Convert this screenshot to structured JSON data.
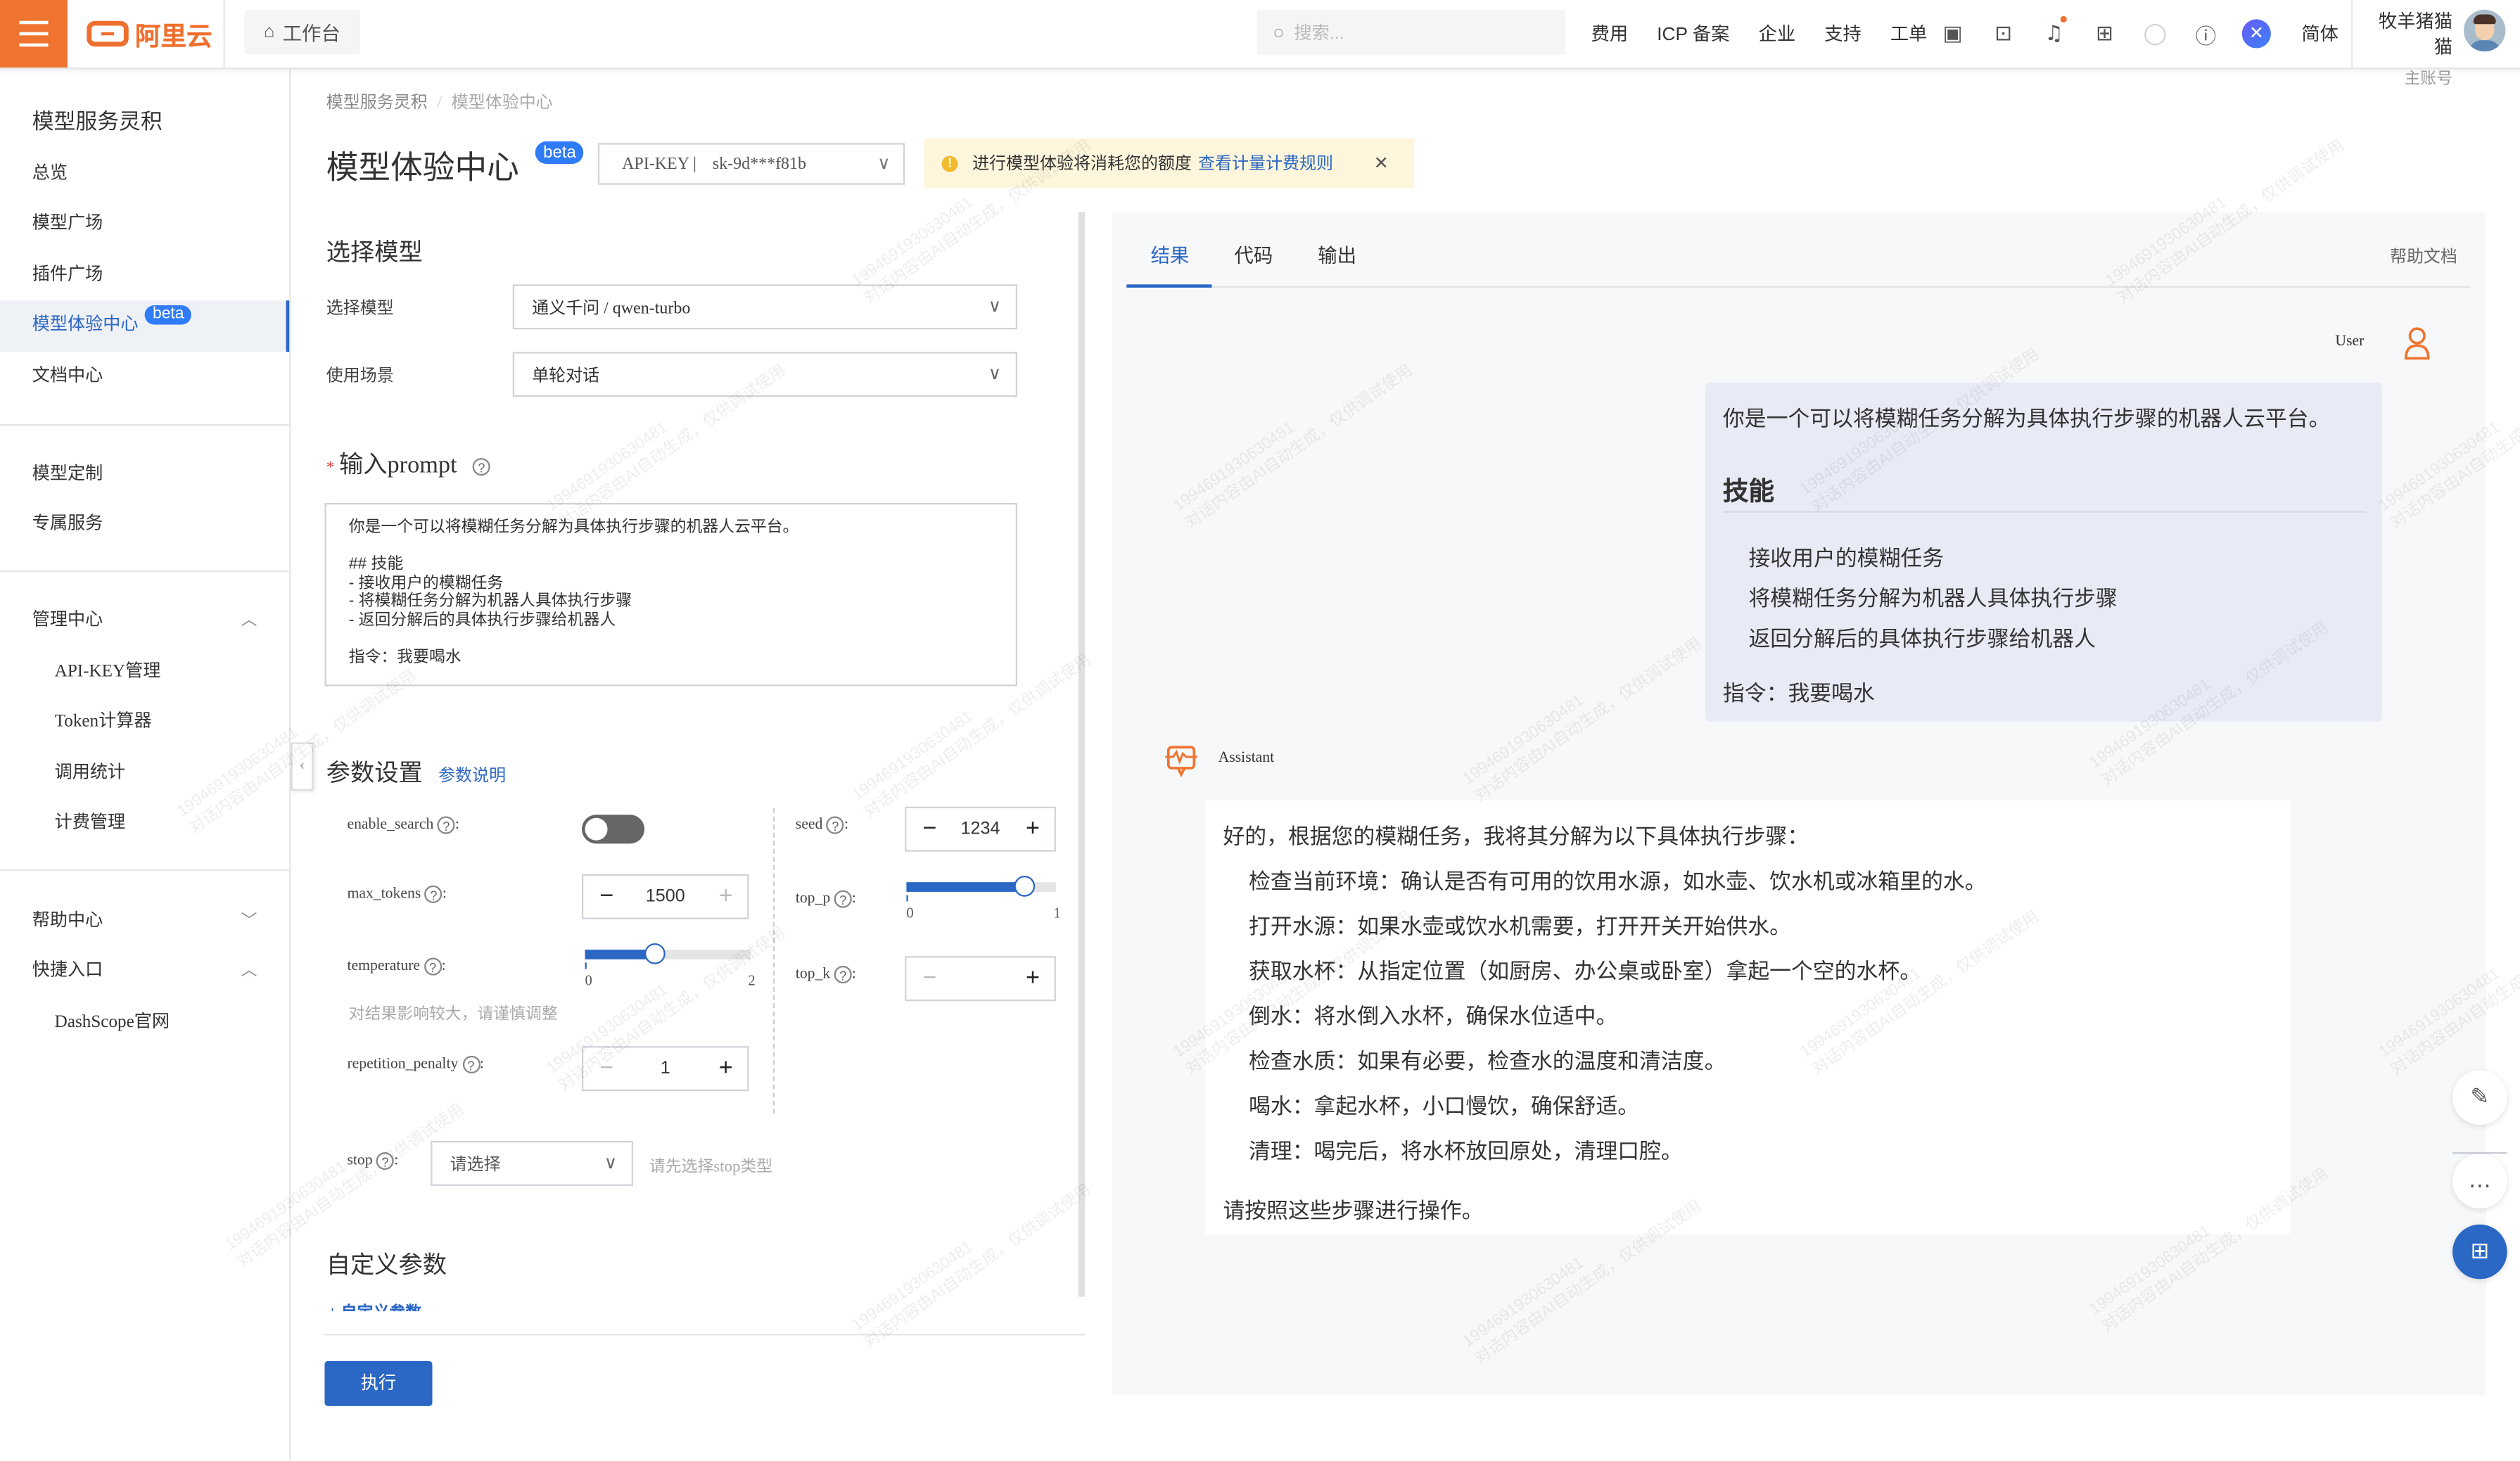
{
  "topbar": {
    "logo_text": "阿里云",
    "workbench_label": "工作台",
    "search_placeholder": "搜索...",
    "nav_links": [
      "费用",
      "ICP 备案",
      "企业",
      "支持",
      "工单"
    ],
    "icons": [
      "app-icon",
      "terminal-icon",
      "bell-icon",
      "cart-icon",
      "lightbulb-icon",
      "help-icon",
      "ai-assistant-icon"
    ],
    "notification_dot_color": "#ef6f2e",
    "language": "简体",
    "user_name": "牧羊猪猫猫",
    "user_role": "主账号"
  },
  "sidebar": {
    "title": "模型服务灵积",
    "items": [
      {
        "label": "总览"
      },
      {
        "label": "模型广场"
      },
      {
        "label": "插件广场"
      },
      {
        "label": "模型体验中心",
        "badge": "beta",
        "active": true
      },
      {
        "label": "文档中心"
      }
    ],
    "items2": [
      {
        "label": "模型定制"
      },
      {
        "label": "专属服务"
      }
    ],
    "groups": [
      {
        "label": "管理中心",
        "expanded": true,
        "children": [
          "API-KEY管理",
          "Token计算器",
          "调用统计",
          "计费管理"
        ]
      },
      {
        "label": "帮助中心",
        "expanded": false,
        "children": []
      },
      {
        "label": "快捷入口",
        "expanded": true,
        "children": [
          "DashScope官网"
        ]
      }
    ]
  },
  "breadcrumb": [
    "模型服务灵积",
    "模型体验中心"
  ],
  "page": {
    "title": "模型体验中心",
    "title_badge": "beta",
    "apikey_label": "API-KEY |",
    "apikey_value": "sk-9d***f81b",
    "notice_text": "进行模型体验将消耗您的额度",
    "notice_link": "查看计量计费规则",
    "accent_color": "#2b67c4"
  },
  "config": {
    "select_model_heading": "选择模型",
    "model_label": "选择模型",
    "model_value": "通义千问 / qwen-turbo",
    "scene_label": "使用场景",
    "scene_value": "单轮对话",
    "prompt_heading": "输入prompt",
    "prompt_value": "你是一个可以将模糊任务分解为具体执行步骤的机器人云平台。\n\n## 技能\n- 接收用户的模糊任务\n- 将模糊任务分解为机器人具体执行步骤\n- 返回分解后的具体执行步骤给机器人\n\n指令：我要喝水",
    "params_heading": "参数设置",
    "params_link": "参数说明",
    "params": {
      "enable_search": {
        "label": "enable_search",
        "value": false
      },
      "max_tokens": {
        "label": "max_tokens",
        "value": "1500"
      },
      "temperature": {
        "label": "temperature",
        "value": 0.85,
        "min": "0",
        "max": "2",
        "hint": "对结果影响较大，请谨慎调整"
      },
      "repetition_penalty": {
        "label": "repetition_penalty",
        "value": "1"
      },
      "seed": {
        "label": "seed",
        "value": "1234"
      },
      "top_p": {
        "label": "top_p",
        "value": 0.8,
        "min": "0",
        "max": "1"
      },
      "top_k": {
        "label": "top_k",
        "value": ""
      },
      "stop": {
        "label": "stop",
        "placeholder": "请选择",
        "hint": "请先选择stop类型"
      }
    },
    "custom_heading": "自定义参数",
    "custom_link": "+ 自定义参数",
    "run_button": "执行"
  },
  "result": {
    "tabs": [
      "结果",
      "代码",
      "输出"
    ],
    "active_tab": 0,
    "help_doc": "帮助文档",
    "user_tag": "User",
    "user_message": {
      "intro": "你是一个可以将模糊任务分解为具体执行步骤的机器人云平台。",
      "heading": "技能",
      "list": [
        "接收用户的模糊任务",
        "将模糊任务分解为机器人具体执行步骤",
        "返回分解后的具体执行步骤给机器人"
      ],
      "instruction": "指令：我要喝水"
    },
    "assistant_tag": "Assistant",
    "assistant_message": {
      "intro": "好的，根据您的模糊任务，我将其分解为以下具体执行步骤：",
      "steps": [
        "检查当前环境：确认是否有可用的饮用水源，如水壶、饮水机或冰箱里的水。",
        "打开水源：如果水壶或饮水机需要，打开开关开始供水。",
        "获取水杯：从指定位置（如厨房、办公桌或卧室）拿起一个空的水杯。",
        "倒水：将水倒入水杯，确保水位适中。",
        "检查水质：如果有必要，检查水的温度和清洁度。",
        "喝水：拿起水杯，小口慢饮，确保舒适。",
        "清理：喝完后，将水杯放回原处，清理口腔。"
      ],
      "outro": "请按照这些步骤进行操作。"
    }
  },
  "floating_buttons": [
    "edit-icon",
    "feedback-icon",
    "apps-icon"
  ],
  "watermark": {
    "line1": "19946919306304​81",
    "line2": "对话内容由AI自动生成，仅供调试使用"
  }
}
